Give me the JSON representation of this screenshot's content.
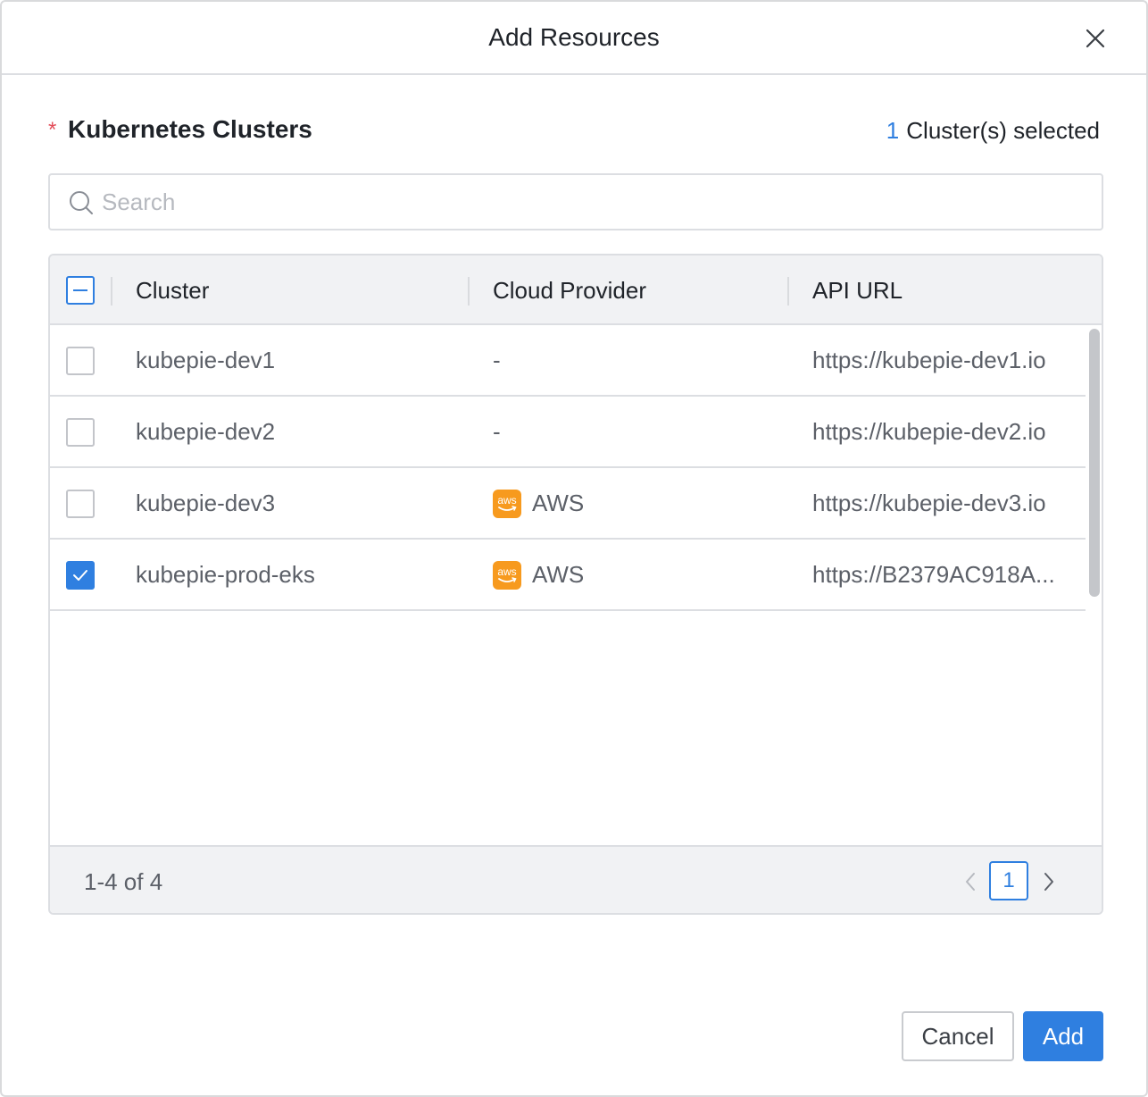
{
  "dialog": {
    "title": "Add Resources",
    "close_icon": "close-icon"
  },
  "section": {
    "required_mark": "*",
    "title": "Kubernetes Clusters",
    "selected_count": "1",
    "selected_suffix": "Cluster(s) selected"
  },
  "search": {
    "placeholder": "Search",
    "value": "",
    "icon": "search-icon"
  },
  "table": {
    "select_all_state": "indeterminate",
    "columns": [
      "Cluster",
      "Cloud Provider",
      "API URL"
    ],
    "rows": [
      {
        "cluster": "kubepie-dev1",
        "provider": "-",
        "provider_icon": "",
        "url": "https://kubepie-dev1.io",
        "checked": false
      },
      {
        "cluster": "kubepie-dev2",
        "provider": "-",
        "provider_icon": "",
        "url": "https://kubepie-dev2.io",
        "checked": false
      },
      {
        "cluster": "kubepie-dev3",
        "provider": "AWS",
        "provider_icon": "aws-logo-icon",
        "url": "https://kubepie-dev3.io",
        "checked": false
      },
      {
        "cluster": "kubepie-prod-eks",
        "provider": "AWS",
        "provider_icon": "aws-logo-icon",
        "url": "https://B2379AC918A...",
        "checked": true
      }
    ],
    "aws_logo_text": "aws"
  },
  "pagination": {
    "range": "1-4 of 4",
    "current_page": "1"
  },
  "footer": {
    "cancel_label": "Cancel",
    "add_label": "Add"
  },
  "colors": {
    "accent": "#2f7fe0",
    "required": "#e34d59",
    "aws": "#f79a1e",
    "header_bg": "#f1f2f4",
    "border": "#dcdee2"
  }
}
